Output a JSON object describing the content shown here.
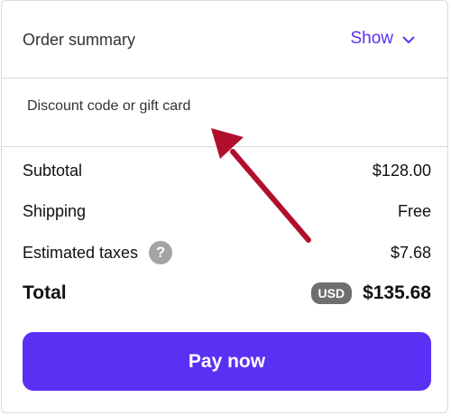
{
  "order_summary": {
    "title": "Order summary",
    "toggle_label": "Show",
    "toggle_icon": "chevron-down-icon",
    "accent_color": "#5a31f4"
  },
  "discount": {
    "placeholder": "Discount code or gift card",
    "value": ""
  },
  "lines": {
    "subtotal": {
      "label": "Subtotal",
      "amount": "$128.00"
    },
    "shipping": {
      "label": "Shipping",
      "amount": "Free"
    },
    "taxes": {
      "label": "Estimated taxes",
      "amount": "$7.68",
      "help_icon": "?"
    }
  },
  "total": {
    "label": "Total",
    "currency": "USD",
    "amount": "$135.68"
  },
  "pay_button": {
    "label": "Pay now",
    "color": "#5a31f4"
  },
  "annotation": {
    "arrow_color": "#b0102c"
  }
}
